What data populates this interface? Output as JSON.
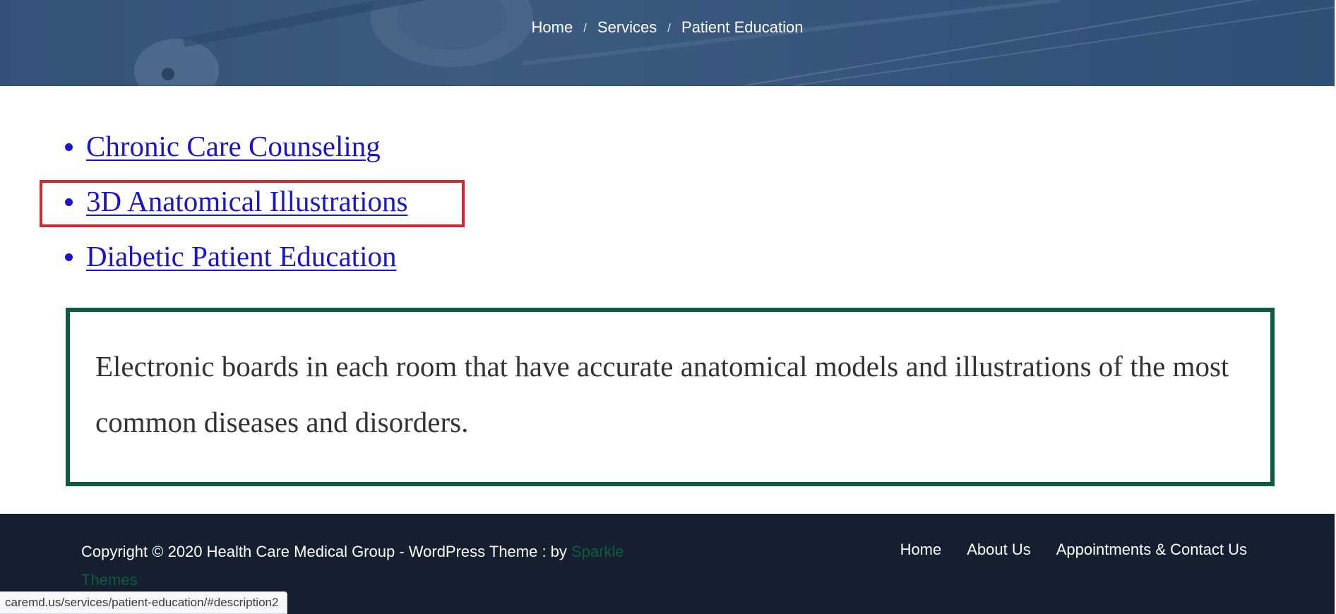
{
  "breadcrumb": {
    "items": [
      "Home",
      "Services",
      "Patient Education"
    ],
    "separator": "/"
  },
  "description_links": [
    {
      "label": "Chronic Care Counseling"
    },
    {
      "label": "3D Anatomical Illustrations",
      "highlighted": true
    },
    {
      "label": "Diabetic Patient Education"
    }
  ],
  "description_text": "Electronic boards in each room that have accurate anatomical models and illustrations of the most common diseases and disorders.",
  "footer": {
    "copyright_text": "Copyright © 2020 Health Care Medical Group - WordPress Theme : by ",
    "credit_link": "Sparkle Themes",
    "nav": [
      "Home",
      "About Us",
      "Appointments & Contact Us"
    ]
  },
  "status_bar_url": "caremd.us/services/patient-education/#description2",
  "colors": {
    "hero_overlay": "#3b5a80",
    "link": "#1b14cf",
    "highlight_border": "#d42630",
    "frame_border": "#0b5a43",
    "footer_bg": "#151f2f",
    "credit_link": "#0f5b43"
  }
}
